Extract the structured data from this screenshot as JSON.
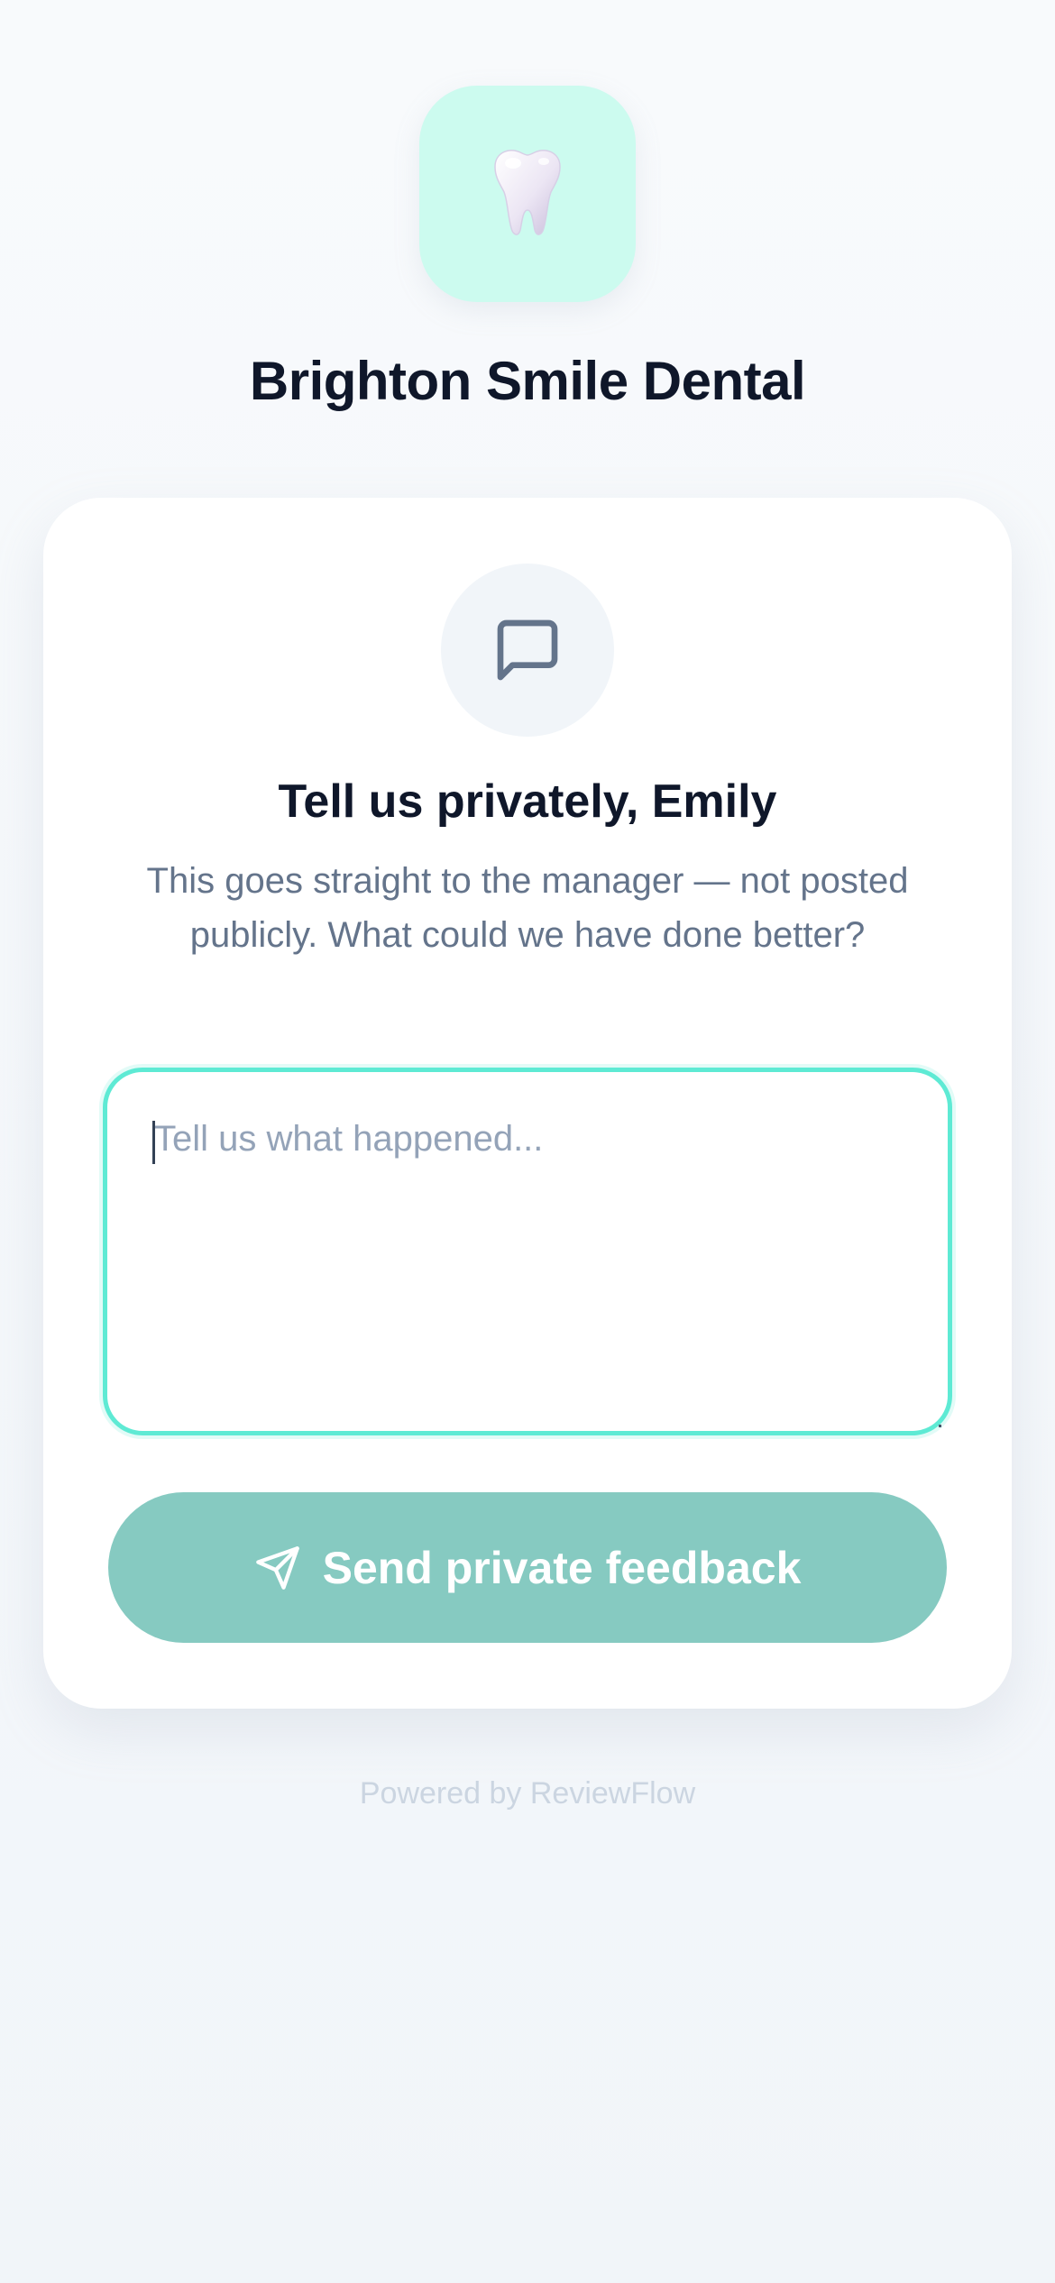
{
  "header": {
    "logo_icon": "tooth-icon",
    "brand_name": "Brighton Smile Dental"
  },
  "card": {
    "icon": "chat-bubble-icon",
    "title": "Tell us privately, Emily",
    "description": "This goes straight to the manager — not posted publicly. What could we have done better?",
    "feedback_input": {
      "value": "",
      "placeholder": "Tell us what happened..."
    },
    "send_button": {
      "icon": "send-icon",
      "label": "Send private feedback"
    }
  },
  "footer": {
    "text": "Powered by ReviewFlow"
  },
  "colors": {
    "accent": "#5eead4",
    "button": "#86cac1",
    "logo_bg": "#ccfbef",
    "title": "#0f172a",
    "muted": "#64748b"
  }
}
